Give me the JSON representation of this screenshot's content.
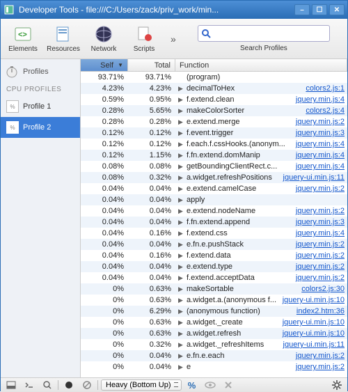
{
  "window": {
    "title": "Developer Tools - file:///C:/Users/zack/priv_work/min..."
  },
  "toolbar": {
    "items": [
      {
        "label": "Elements"
      },
      {
        "label": "Resources"
      },
      {
        "label": "Network"
      },
      {
        "label": "Scripts"
      }
    ],
    "search_placeholder": "",
    "search_label": "Search Profiles"
  },
  "sidebar": {
    "heading": "Profiles",
    "subheading": "CPU PROFILES",
    "items": [
      {
        "label": "Profile 1",
        "active": false
      },
      {
        "label": "Profile 2",
        "active": true
      }
    ]
  },
  "columns": {
    "self": "Self",
    "total": "Total",
    "func": "Function"
  },
  "rows": [
    {
      "self": "93.71%",
      "total": "93.71%",
      "func": "(program)",
      "src": "",
      "expand": false
    },
    {
      "self": "4.23%",
      "total": "4.23%",
      "func": "decimalToHex",
      "src": "colors2.js:1",
      "expand": true
    },
    {
      "self": "0.59%",
      "total": "0.95%",
      "func": "f.extend.clean",
      "src": "jquery.min.js:4",
      "expand": true
    },
    {
      "self": "0.28%",
      "total": "5.65%",
      "func": "makeColorSorter",
      "src": "colors2.js:4",
      "expand": true
    },
    {
      "self": "0.28%",
      "total": "0.28%",
      "func": "e.extend.merge",
      "src": "jquery.min.js:2",
      "expand": true
    },
    {
      "self": "0.12%",
      "total": "0.12%",
      "func": "f.event.trigger",
      "src": "jquery.min.js:3",
      "expand": true
    },
    {
      "self": "0.12%",
      "total": "0.12%",
      "func": "f.each.f.cssHooks.(anonym...",
      "src": "jquery.min.js:4",
      "expand": true
    },
    {
      "self": "0.12%",
      "total": "1.15%",
      "func": "f.fn.extend.domManip",
      "src": "jquery.min.js:4",
      "expand": true
    },
    {
      "self": "0.08%",
      "total": "0.08%",
      "func": "getBoundingClientRect.c...",
      "src": "jquery.min.js:4",
      "expand": true
    },
    {
      "self": "0.08%",
      "total": "0.32%",
      "func": "a.widget.refreshPositions",
      "src": "jquery-ui.min.js:11",
      "expand": true
    },
    {
      "self": "0.04%",
      "total": "0.04%",
      "func": "e.extend.camelCase",
      "src": "jquery.min.js:2",
      "expand": true
    },
    {
      "self": "0.04%",
      "total": "0.04%",
      "func": "apply",
      "src": "",
      "expand": true
    },
    {
      "self": "0.04%",
      "total": "0.04%",
      "func": "e.extend.nodeName",
      "src": "jquery.min.js:2",
      "expand": true
    },
    {
      "self": "0.04%",
      "total": "0.04%",
      "func": "f.fn.extend.append",
      "src": "jquery.min.js:3",
      "expand": true
    },
    {
      "self": "0.04%",
      "total": "0.16%",
      "func": "f.extend.css",
      "src": "jquery.min.js:4",
      "expand": true
    },
    {
      "self": "0.04%",
      "total": "0.04%",
      "func": "e.fn.e.pushStack",
      "src": "jquery.min.js:2",
      "expand": true
    },
    {
      "self": "0.04%",
      "total": "0.16%",
      "func": "f.extend.data",
      "src": "jquery.min.js:2",
      "expand": true
    },
    {
      "self": "0.04%",
      "total": "0.04%",
      "func": "e.extend.type",
      "src": "jquery.min.js:2",
      "expand": true
    },
    {
      "self": "0.04%",
      "total": "0.04%",
      "func": "f.extend.acceptData",
      "src": "jquery.min.js:2",
      "expand": true
    },
    {
      "self": "0%",
      "total": "0.63%",
      "func": "makeSortable",
      "src": "colors2.js:30",
      "expand": true
    },
    {
      "self": "0%",
      "total": "0.63%",
      "func": "a.widget.a.(anonymous f...",
      "src": "jquery-ui.min.js:10",
      "expand": true
    },
    {
      "self": "0%",
      "total": "6.29%",
      "func": "(anonymous function)",
      "src": "index2.htm:36",
      "expand": true
    },
    {
      "self": "0%",
      "total": "0.63%",
      "func": "a.widget._create",
      "src": "jquery-ui.min.js:10",
      "expand": true
    },
    {
      "self": "0%",
      "total": "0.63%",
      "func": "a.widget.refresh",
      "src": "jquery-ui.min.js:10",
      "expand": true
    },
    {
      "self": "0%",
      "total": "0.32%",
      "func": "a.widget._refreshItems",
      "src": "jquery-ui.min.js:11",
      "expand": true
    },
    {
      "self": "0%",
      "total": "0.04%",
      "func": "e.fn.e.each",
      "src": "jquery.min.js:2",
      "expand": true
    },
    {
      "self": "0%",
      "total": "0.04%",
      "func": "e",
      "src": "jquery.min.js:2",
      "expand": true
    }
  ],
  "statusbar": {
    "heavy": "Heavy (Bottom Up)",
    "pct": "%"
  }
}
